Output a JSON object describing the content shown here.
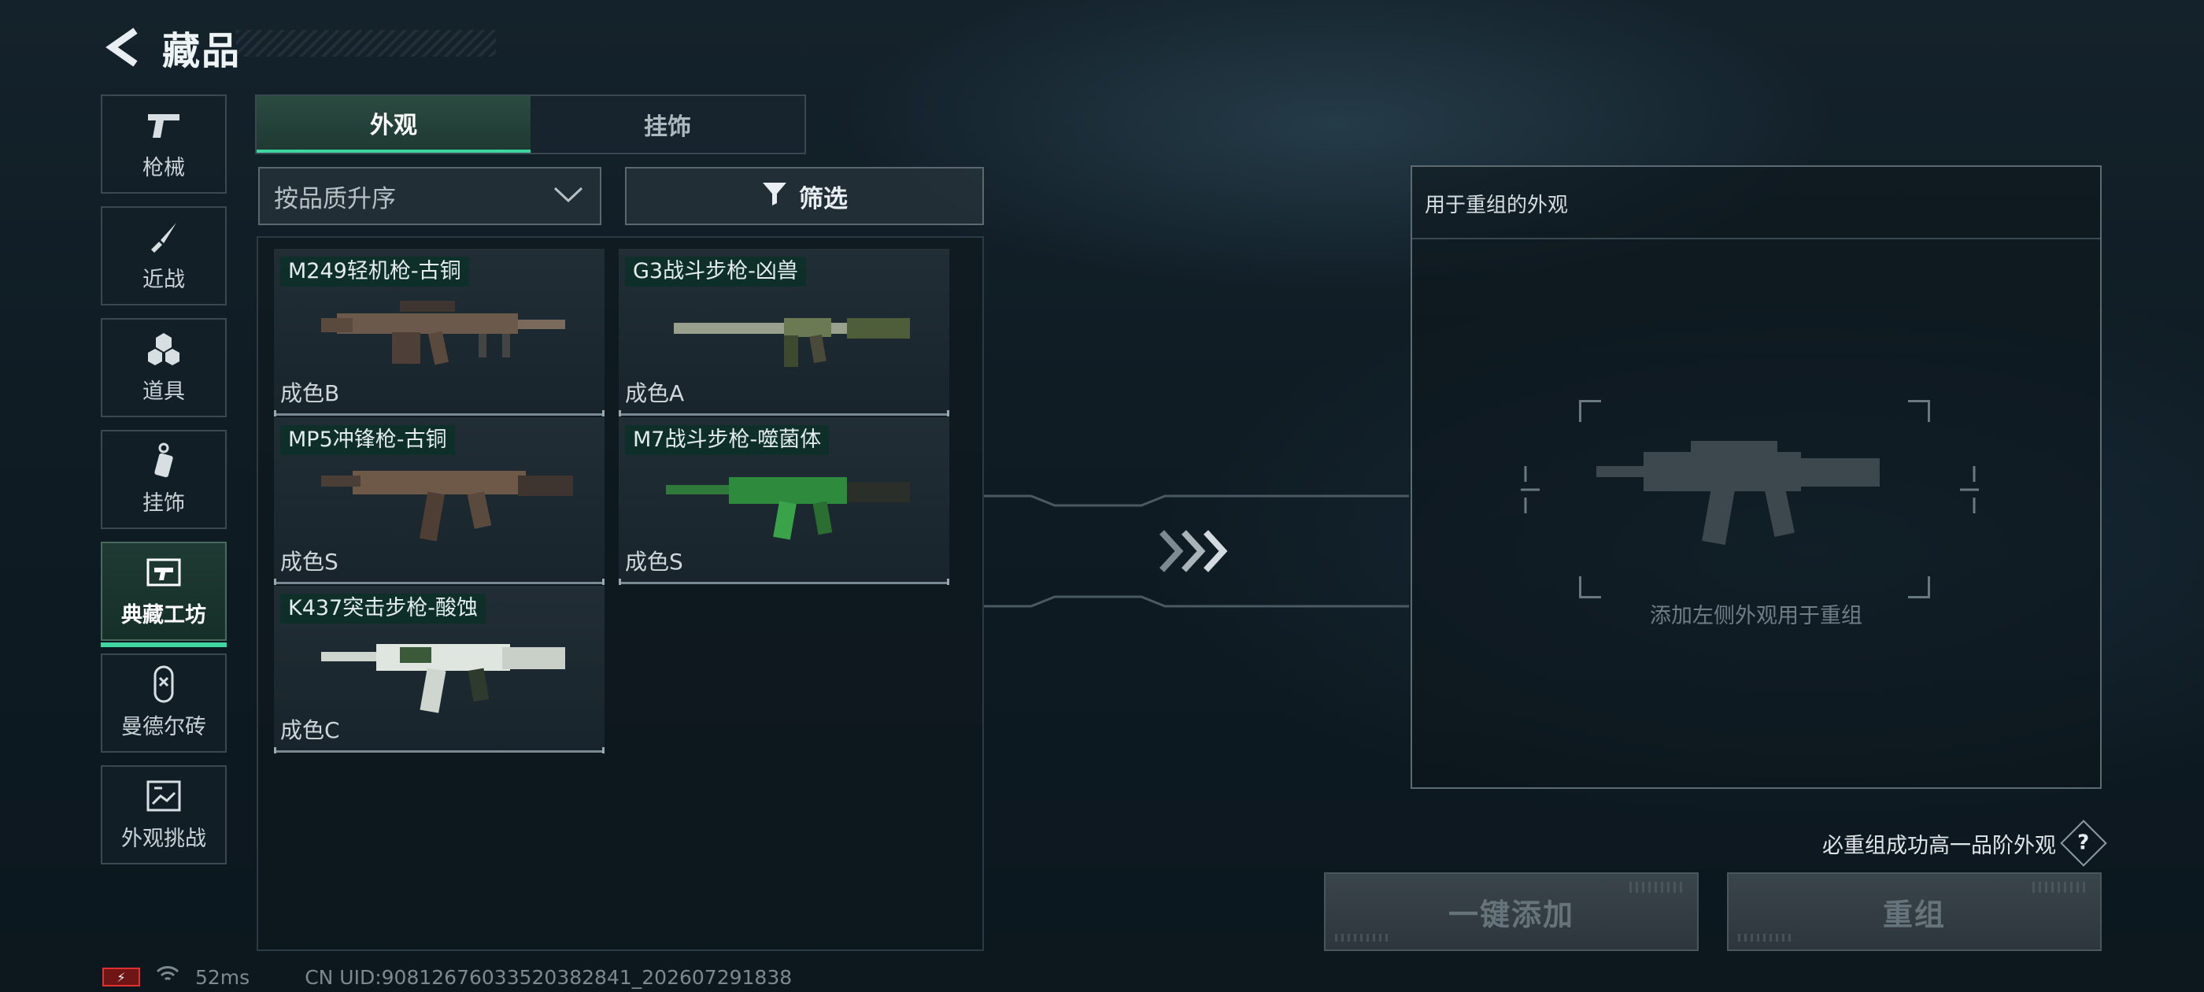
{
  "header": {
    "title": "藏品"
  },
  "sidebar": {
    "items": [
      {
        "label": "枪械",
        "icon": "pistol-icon"
      },
      {
        "label": "近战",
        "icon": "knife-icon"
      },
      {
        "label": "道具",
        "icon": "grenade-icon"
      },
      {
        "label": "挂饰",
        "icon": "charm-icon"
      },
      {
        "label": "典藏工坊",
        "icon": "workshop-icon",
        "active": true
      },
      {
        "label": "曼德尔砖",
        "icon": "brick-icon"
      },
      {
        "label": "外观挑战",
        "icon": "challenge-icon"
      }
    ]
  },
  "tabs": [
    {
      "label": "外观",
      "active": true
    },
    {
      "label": "挂饰",
      "active": false
    }
  ],
  "sort": {
    "value": "按品质升序"
  },
  "filter": {
    "label": "筛选"
  },
  "items": [
    {
      "name": "M249轻机枪-古铜",
      "grade": "成色B"
    },
    {
      "name": "G3战斗步枪-凶兽",
      "grade": "成色A"
    },
    {
      "name": "MP5冲锋枪-古铜",
      "grade": "成色S"
    },
    {
      "name": "M7战斗步枪-噬菌体",
      "grade": "成色S"
    },
    {
      "name": "K437突击步枪-酸蚀",
      "grade": "成色C"
    }
  ],
  "recombine": {
    "title": "用于重组的外观",
    "hint": "添加左侧外观用于重组",
    "note": "必重组成功高一品阶外观",
    "help": "?",
    "add_all": "一键添加",
    "recombine": "重组"
  },
  "status": {
    "ping": "52ms",
    "uid": "CN UID:90812676033520382841_202607291838"
  },
  "colors": {
    "accent": "#3fd6a0",
    "background": "#0f1c24"
  }
}
